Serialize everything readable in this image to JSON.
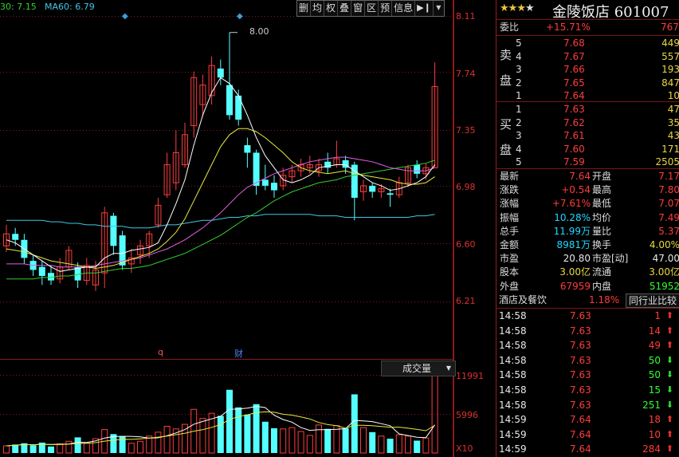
{
  "ma_header": {
    "ma30": "30: 7.15",
    "ma60": "MA60: 6.79"
  },
  "toolbar": [
    "删",
    "均",
    "权",
    "叠",
    "窗",
    "区",
    "预",
    "信息"
  ],
  "price_axis": [
    "8.11",
    "7.74",
    "7.35",
    "6.98",
    "6.60",
    "6.21"
  ],
  "volume_axis": [
    "11991",
    "5996",
    "X10"
  ],
  "volume_header": "成交量",
  "high_marker": "8.00",
  "bottom_markers": {
    "q": "q",
    "cai": "财"
  },
  "colors": {
    "up": "#ff3c3c",
    "down": "#54ffff",
    "ma5": "#ffffff",
    "ma10": "#e8e840",
    "ma20": "#e060e0",
    "ma30": "#30d030",
    "ma60": "#40c8e8",
    "grid": "#8b1a1a"
  },
  "chart_data": {
    "type": "candlestick",
    "ylim": [
      6.0,
      8.11
    ],
    "candles": [
      {
        "o": 6.58,
        "c": 6.66,
        "h": 6.72,
        "l": 6.54,
        "v": 1100
      },
      {
        "o": 6.66,
        "c": 6.62,
        "h": 6.7,
        "l": 6.58,
        "v": 1300
      },
      {
        "o": 6.62,
        "c": 6.5,
        "h": 6.66,
        "l": 6.46,
        "v": 1500
      },
      {
        "o": 6.48,
        "c": 6.42,
        "h": 6.52,
        "l": 6.38,
        "v": 1200
      },
      {
        "o": 6.44,
        "c": 6.38,
        "h": 6.48,
        "l": 6.32,
        "v": 1600
      },
      {
        "o": 6.4,
        "c": 6.35,
        "h": 6.45,
        "l": 6.32,
        "v": 1000
      },
      {
        "o": 6.36,
        "c": 6.44,
        "h": 6.5,
        "l": 6.33,
        "v": 1400
      },
      {
        "o": 6.44,
        "c": 6.55,
        "h": 6.58,
        "l": 6.42,
        "v": 1800
      },
      {
        "o": 6.44,
        "c": 6.35,
        "h": 6.47,
        "l": 6.3,
        "v": 2400
      },
      {
        "o": 6.35,
        "c": 6.45,
        "h": 6.5,
        "l": 6.32,
        "v": 1500
      },
      {
        "o": 6.32,
        "c": 6.42,
        "h": 6.48,
        "l": 6.28,
        "v": 2200
      },
      {
        "o": 6.4,
        "c": 6.8,
        "h": 6.84,
        "l": 6.3,
        "v": 3600
      },
      {
        "o": 6.78,
        "c": 6.58,
        "h": 6.8,
        "l": 6.52,
        "v": 2900
      },
      {
        "o": 6.65,
        "c": 6.45,
        "h": 6.68,
        "l": 6.42,
        "v": 2600
      },
      {
        "o": 6.46,
        "c": 6.5,
        "h": 6.56,
        "l": 6.4,
        "v": 1500
      },
      {
        "o": 6.52,
        "c": 6.58,
        "h": 6.62,
        "l": 6.46,
        "v": 1800
      },
      {
        "o": 6.58,
        "c": 6.66,
        "h": 6.68,
        "l": 6.5,
        "v": 2600
      },
      {
        "o": 6.72,
        "c": 6.85,
        "h": 6.9,
        "l": 6.7,
        "v": 3200
      },
      {
        "o": 6.92,
        "c": 7.12,
        "h": 7.2,
        "l": 6.9,
        "v": 4100
      },
      {
        "o": 7.0,
        "c": 7.2,
        "h": 7.35,
        "l": 6.95,
        "v": 3700
      },
      {
        "o": 7.12,
        "c": 7.32,
        "h": 7.4,
        "l": 7.1,
        "v": 4400
      },
      {
        "o": 7.38,
        "c": 7.7,
        "h": 7.74,
        "l": 7.3,
        "v": 6700
      },
      {
        "o": 7.52,
        "c": 7.65,
        "h": 7.72,
        "l": 7.44,
        "v": 5300
      },
      {
        "o": 7.58,
        "c": 7.78,
        "h": 7.84,
        "l": 7.52,
        "v": 6100
      },
      {
        "o": 7.76,
        "c": 7.7,
        "h": 7.82,
        "l": 7.65,
        "v": 5700
      },
      {
        "o": 7.65,
        "c": 7.45,
        "h": 8.0,
        "l": 7.42,
        "v": 9700
      },
      {
        "o": 7.58,
        "c": 7.42,
        "h": 7.62,
        "l": 7.38,
        "v": 7000
      },
      {
        "o": 7.25,
        "c": 7.2,
        "h": 7.3,
        "l": 7.1,
        "v": 5900
      },
      {
        "o": 7.2,
        "c": 6.98,
        "h": 7.22,
        "l": 6.92,
        "v": 7500
      },
      {
        "o": 7.02,
        "c": 6.98,
        "h": 7.12,
        "l": 6.95,
        "v": 4800
      },
      {
        "o": 7.0,
        "c": 6.95,
        "h": 7.05,
        "l": 6.9,
        "v": 3800
      },
      {
        "o": 6.98,
        "c": 7.05,
        "h": 7.1,
        "l": 6.95,
        "v": 3700
      },
      {
        "o": 7.04,
        "c": 7.08,
        "h": 7.12,
        "l": 7.0,
        "v": 3900
      },
      {
        "o": 7.08,
        "c": 7.12,
        "h": 7.16,
        "l": 7.04,
        "v": 3300
      },
      {
        "o": 7.1,
        "c": 7.12,
        "h": 7.18,
        "l": 7.06,
        "v": 2700
      },
      {
        "o": 7.08,
        "c": 7.12,
        "h": 7.16,
        "l": 7.04,
        "v": 4300
      },
      {
        "o": 7.14,
        "c": 7.1,
        "h": 7.2,
        "l": 7.06,
        "v": 3700
      },
      {
        "o": 7.12,
        "c": 7.16,
        "h": 7.28,
        "l": 7.1,
        "v": 4200
      },
      {
        "o": 7.15,
        "c": 7.1,
        "h": 7.18,
        "l": 7.06,
        "v": 3800
      },
      {
        "o": 7.12,
        "c": 6.9,
        "h": 7.14,
        "l": 6.75,
        "v": 9000
      },
      {
        "o": 6.94,
        "c": 6.98,
        "h": 7.02,
        "l": 6.88,
        "v": 3900
      },
      {
        "o": 6.98,
        "c": 6.94,
        "h": 7.0,
        "l": 6.9,
        "v": 3200
      },
      {
        "o": 6.94,
        "c": 6.96,
        "h": 6.99,
        "l": 6.9,
        "v": 2600
      },
      {
        "o": 6.93,
        "c": 6.92,
        "h": 6.96,
        "l": 6.84,
        "v": 2200
      },
      {
        "o": 6.92,
        "c": 7.0,
        "h": 7.04,
        "l": 6.9,
        "v": 2800
      },
      {
        "o": 7.0,
        "c": 7.1,
        "h": 7.12,
        "l": 6.97,
        "v": 2600
      },
      {
        "o": 7.12,
        "c": 7.06,
        "h": 7.15,
        "l": 7.03,
        "v": 1900
      },
      {
        "o": 7.06,
        "c": 7.1,
        "h": 7.13,
        "l": 7.02,
        "v": 2300
      },
      {
        "o": 7.1,
        "c": 7.64,
        "h": 7.8,
        "l": 7.1,
        "v": 11991
      }
    ],
    "ma5": [
      6.62,
      6.6,
      6.56,
      6.52,
      6.48,
      6.44,
      6.41,
      6.42,
      6.43,
      6.44,
      6.44,
      6.5,
      6.53,
      6.53,
      6.55,
      6.56,
      6.57,
      6.6,
      6.72,
      6.86,
      7.02,
      7.25,
      7.45,
      7.6,
      7.7,
      7.66,
      7.58,
      7.45,
      7.3,
      7.18,
      7.1,
      7.02,
      7.0,
      7.02,
      7.05,
      7.1,
      7.11,
      7.12,
      7.12,
      7.08,
      7.04,
      7.0,
      6.98,
      6.95,
      6.96,
      6.98,
      7.0,
      7.04,
      7.12
    ],
    "ma10": [
      6.56,
      6.55,
      6.54,
      6.52,
      6.5,
      6.48,
      6.47,
      6.46,
      6.45,
      6.44,
      6.43,
      6.44,
      6.45,
      6.47,
      6.49,
      6.51,
      6.53,
      6.56,
      6.61,
      6.67,
      6.76,
      6.88,
      7.0,
      7.12,
      7.24,
      7.32,
      7.36,
      7.36,
      7.34,
      7.3,
      7.25,
      7.2,
      7.14,
      7.1,
      7.08,
      7.07,
      7.06,
      7.07,
      7.08,
      7.06,
      7.05,
      7.04,
      7.03,
      7.02,
      7.0,
      6.99,
      6.99,
      7.0,
      7.04
    ],
    "ma20": [
      6.46,
      6.46,
      6.46,
      6.45,
      6.45,
      6.45,
      6.44,
      6.44,
      6.44,
      6.44,
      6.45,
      6.46,
      6.47,
      6.48,
      6.49,
      6.5,
      6.52,
      6.54,
      6.56,
      6.59,
      6.62,
      6.66,
      6.7,
      6.75,
      6.8,
      6.86,
      6.92,
      6.97,
      7.0,
      7.03,
      7.06,
      7.08,
      7.1,
      7.12,
      7.14,
      7.15,
      7.16,
      7.17,
      7.17,
      7.16,
      7.15,
      7.14,
      7.12,
      7.1,
      7.09,
      7.08,
      7.08,
      7.08,
      7.1
    ],
    "ma30": [
      6.36,
      6.36,
      6.36,
      6.36,
      6.37,
      6.37,
      6.38,
      6.38,
      6.39,
      6.4,
      6.4,
      6.41,
      6.42,
      6.43,
      6.43,
      6.44,
      6.45,
      6.47,
      6.49,
      6.51,
      6.53,
      6.56,
      6.59,
      6.62,
      6.65,
      6.69,
      6.73,
      6.77,
      6.8,
      6.84,
      6.88,
      6.91,
      6.94,
      6.96,
      6.98,
      7.0,
      7.01,
      7.02,
      7.04,
      7.05,
      7.06,
      7.07,
      7.08,
      7.09,
      7.1,
      7.11,
      7.12,
      7.13,
      7.15
    ],
    "ma60": [
      6.75,
      6.75,
      6.75,
      6.75,
      6.75,
      6.74,
      6.74,
      6.73,
      6.73,
      6.72,
      6.72,
      6.71,
      6.71,
      6.71,
      6.7,
      6.7,
      6.7,
      6.71,
      6.72,
      6.72,
      6.73,
      6.74,
      6.75,
      6.75,
      6.76,
      6.77,
      6.77,
      6.78,
      6.78,
      6.79,
      6.79,
      6.79,
      6.79,
      6.79,
      6.79,
      6.78,
      6.78,
      6.78,
      6.77,
      6.77,
      6.77,
      6.77,
      6.77,
      6.77,
      6.77,
      6.77,
      6.78,
      6.78,
      6.79
    ]
  },
  "quote": {
    "stars_filled": 3,
    "stars_total": 4,
    "title": "金陵饭店 601007",
    "weibi": {
      "label": "委比",
      "value": "+15.71%",
      "extra": "767"
    },
    "sell_char1": "卖",
    "sell_char2": "盘",
    "buy_char1": "买",
    "buy_char2": "盘",
    "sell": [
      {
        "n": "5",
        "p": "7.68",
        "v": "449"
      },
      {
        "n": "4",
        "p": "7.67",
        "v": "557"
      },
      {
        "n": "3",
        "p": "7.66",
        "v": "193"
      },
      {
        "n": "2",
        "p": "7.65",
        "v": "847"
      },
      {
        "n": "1",
        "p": "7.64",
        "v": "10"
      }
    ],
    "buy": [
      {
        "n": "1",
        "p": "7.63",
        "v": "47"
      },
      {
        "n": "2",
        "p": "7.62",
        "v": "35"
      },
      {
        "n": "3",
        "p": "7.61",
        "v": "43"
      },
      {
        "n": "4",
        "p": "7.60",
        "v": "171"
      },
      {
        "n": "5",
        "p": "7.59",
        "v": "2505"
      }
    ],
    "stats": [
      {
        "l1": "最新",
        "v1": "7.64",
        "c1": "red",
        "l2": "开盘",
        "v2": "7.17",
        "c2": "red"
      },
      {
        "l1": "涨跌",
        "v1": "+0.54",
        "c1": "red",
        "l2": "最高",
        "v2": "7.80",
        "c2": "red"
      },
      {
        "l1": "涨幅",
        "v1": "+7.61%",
        "c1": "red",
        "l2": "最低",
        "v2": "7.07",
        "c2": "red"
      },
      {
        "l1": "振幅",
        "v1": "10.28%",
        "c1": "cyan",
        "l2": "均价",
        "v2": "7.49",
        "c2": "red"
      },
      {
        "l1": "总手",
        "v1": "11.99万",
        "c1": "cyan",
        "l2": "量比",
        "v2": "5.37",
        "c2": "red"
      },
      {
        "l1": "金额",
        "v1": "8981万",
        "c1": "cyan",
        "l2": "换手",
        "v2": "4.00%",
        "c2": "yel"
      },
      {
        "l1": "市盈",
        "v1": "20.80",
        "c1": "wht",
        "l2": "市盈[动]",
        "v2": "47.00",
        "c2": "wht"
      },
      {
        "l1": "股本",
        "v1": "3.00亿",
        "c1": "yel",
        "l2": "流通",
        "v2": "3.00亿",
        "c2": "yel"
      },
      {
        "l1": "外盘",
        "v1": "67959",
        "c1": "red",
        "l2": "内盘",
        "v2": "51952",
        "c2": "grn"
      }
    ],
    "industry": {
      "name": "酒店及餐饮",
      "pct": "1.18%",
      "button": "同行业比较"
    },
    "ticks": [
      {
        "t": "14:58",
        "p": "7.63",
        "v": "1",
        "d": "up"
      },
      {
        "t": "14:58",
        "p": "7.63",
        "v": "14",
        "d": "up"
      },
      {
        "t": "14:58",
        "p": "7.63",
        "v": "49",
        "d": "up"
      },
      {
        "t": "14:58",
        "p": "7.63",
        "v": "50",
        "d": "dn"
      },
      {
        "t": "14:58",
        "p": "7.63",
        "v": "50",
        "d": "dn"
      },
      {
        "t": "14:58",
        "p": "7.63",
        "v": "15",
        "d": "dn"
      },
      {
        "t": "14:58",
        "p": "7.63",
        "v": "251",
        "d": "dn"
      },
      {
        "t": "14:59",
        "p": "7.64",
        "v": "18",
        "d": "up"
      },
      {
        "t": "14:59",
        "p": "7.64",
        "v": "10",
        "d": "up"
      },
      {
        "t": "14:59",
        "p": "7.64",
        "v": "284",
        "d": "up"
      }
    ]
  }
}
